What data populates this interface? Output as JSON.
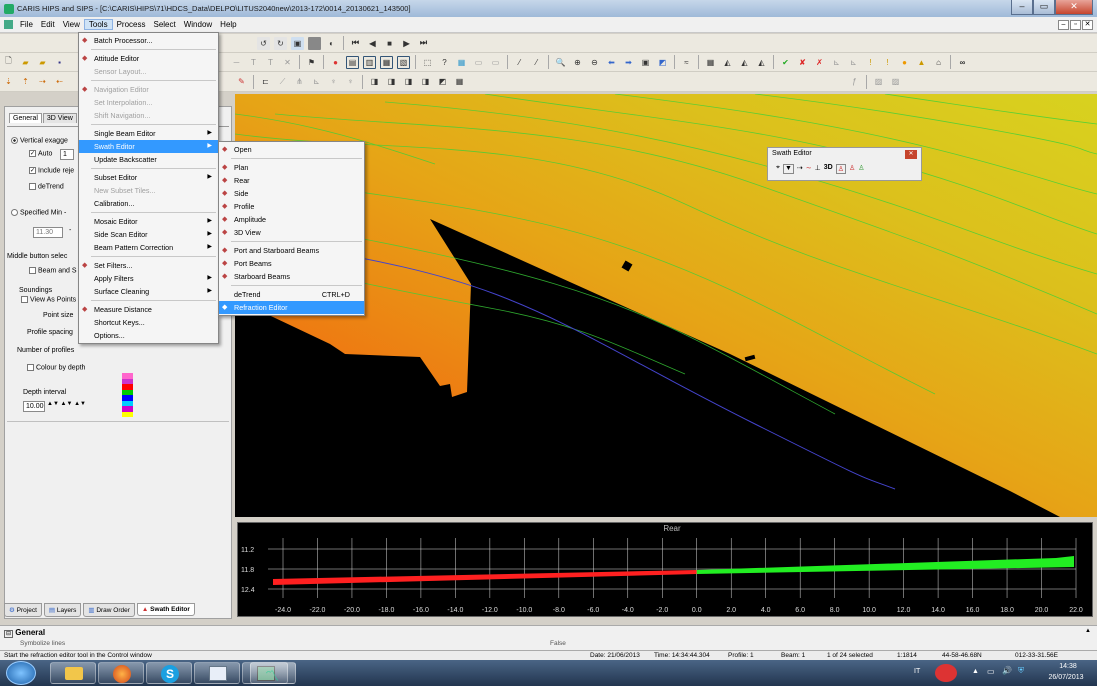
{
  "title": "CARIS HIPS and SIPS - [C:\\CARIS\\HIPS\\71\\HDCS_Data\\DELPO\\LITUS2040new\\2013-172\\0014_20130621_143500]",
  "menubar": [
    "File",
    "Edit",
    "View",
    "Tools",
    "Process",
    "Select",
    "Window",
    "Help"
  ],
  "tools_menu": [
    {
      "label": "Batch Processor...",
      "icon": "gear-icon",
      "enabled": true
    },
    {
      "sep": true
    },
    {
      "label": "Attitude Editor",
      "icon": "attitude-icon",
      "enabled": true
    },
    {
      "label": "Sensor Layout...",
      "enabled": false
    },
    {
      "sep": true
    },
    {
      "label": "Navigation Editor",
      "icon": "navigation-icon",
      "enabled": false
    },
    {
      "label": "Set Interpolation...",
      "enabled": false
    },
    {
      "label": "Shift Navigation...",
      "enabled": false
    },
    {
      "sep": true
    },
    {
      "label": "Single Beam Editor",
      "enabled": true,
      "submenu": true
    },
    {
      "label": "Swath Editor",
      "enabled": true,
      "submenu": true,
      "highlight": true
    },
    {
      "label": "Update Backscatter",
      "enabled": true
    },
    {
      "sep": true
    },
    {
      "label": "Subset Editor",
      "enabled": true,
      "submenu": true
    },
    {
      "label": "New Subset Tiles...",
      "enabled": false
    },
    {
      "label": "Calibration...",
      "enabled": true
    },
    {
      "sep": true
    },
    {
      "label": "Mosaic Editor",
      "enabled": true,
      "submenu": true
    },
    {
      "label": "Side Scan Editor",
      "enabled": true,
      "submenu": true
    },
    {
      "label": "Beam Pattern Correction",
      "enabled": true,
      "submenu": true
    },
    {
      "sep": true
    },
    {
      "label": "Set Filters...",
      "icon": "filter-icon",
      "enabled": true
    },
    {
      "label": "Apply Filters",
      "enabled": true,
      "submenu": true
    },
    {
      "label": "Surface Cleaning",
      "enabled": true,
      "submenu": true
    },
    {
      "sep": true
    },
    {
      "label": "Measure Distance",
      "icon": "ruler-icon",
      "enabled": true
    },
    {
      "label": "Shortcut Keys...",
      "enabled": true
    },
    {
      "label": "Options...",
      "enabled": true
    }
  ],
  "swath_submenu": [
    {
      "label": "Open",
      "icon": "open-icon"
    },
    {
      "sep": true
    },
    {
      "label": "Plan",
      "icon": "plan-icon"
    },
    {
      "label": "Rear",
      "icon": "rear-icon"
    },
    {
      "label": "Side",
      "icon": "side-icon"
    },
    {
      "label": "Profile",
      "icon": "profile-icon"
    },
    {
      "label": "Amplitude",
      "icon": "amplitude-icon"
    },
    {
      "label": "3D View",
      "icon": "3d-icon"
    },
    {
      "sep": true
    },
    {
      "label": "Port and Starboard Beams",
      "icon": "beams-icon"
    },
    {
      "label": "Port Beams",
      "icon": "port-beams-icon"
    },
    {
      "label": "Starboard Beams",
      "icon": "starboard-beams-icon"
    },
    {
      "sep": true
    },
    {
      "label": "deTrend",
      "shortcut": "CTRL+D"
    },
    {
      "label": "Refraction Editor",
      "icon": "refraction-icon",
      "highlight": true
    }
  ],
  "panel": {
    "tabs": [
      "General",
      "3D View"
    ],
    "vertical_exag": "Vertical exagge",
    "auto": "Auto",
    "auto_value": "1",
    "include_rej": "Include reje",
    "detrend": "deTrend",
    "specified_min": "Specified Min -",
    "min_value": "11.30",
    "middle_button": "Middle button selec",
    "beam_and": "Beam and S",
    "soundings": "Soundings",
    "view_as_points": "View As Points",
    "point_size": "Point size",
    "profile_spacing": "Profile spacing",
    "number_profiles": "Number of profiles",
    "colour_by_depth": "Colour by depth",
    "depth_interval": "Depth interval",
    "depth_value": "10.00",
    "depth_colors": [
      "#ff66cc",
      "#cc33cc",
      "#ff0000",
      "#00cc00",
      "#0000ff",
      "#00ccff",
      "#cc00cc",
      "#ffff00"
    ]
  },
  "bottom_tabs": [
    "Project",
    "Layers",
    "Draw Order",
    "Swath Editor"
  ],
  "swath_toolbar": {
    "title": "Swath Editor"
  },
  "rear": {
    "title": "Rear",
    "y_ticks": [
      "11.2",
      "11.8",
      "12.4"
    ],
    "x_ticks": [
      "-24.0",
      "-22.0",
      "-20.0",
      "-18.0",
      "-16.0",
      "-14.0",
      "-12.0",
      "-10.0",
      "-8.0",
      "-6.0",
      "-4.0",
      "-2.0",
      "0.0",
      "2.0",
      "4.0",
      "6.0",
      "8.0",
      "10.0",
      "12.0",
      "14.0",
      "16.0",
      "18.0",
      "20.0",
      "22.0"
    ]
  },
  "general": {
    "title": "General",
    "row1": "Symbolize lines",
    "row2": "False"
  },
  "status": {
    "hint": "Start the refraction editor tool in the Control window",
    "date": "Date: 21/06/2013",
    "time": "Time: 14:34:44.304",
    "profile": "Profile: 1",
    "beam": "Beam: 1",
    "selected": "1 of 24 selected",
    "scale": "1:1814",
    "lat": "44-58-46.68N",
    "lon": "012-33-31.56E"
  },
  "tray": {
    "lang": "IT",
    "time": "14:38",
    "date": "26/07/2013"
  },
  "colors": {
    "selection": "#3399ff",
    "port": "#ff2020",
    "starboard": "#22ee22"
  }
}
